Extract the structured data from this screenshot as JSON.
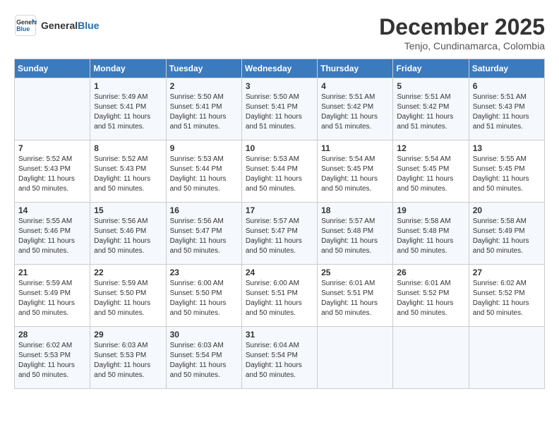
{
  "header": {
    "logo_line1": "General",
    "logo_line2": "Blue",
    "month": "December 2025",
    "location": "Tenjo, Cundinamarca, Colombia"
  },
  "days_of_week": [
    "Sunday",
    "Monday",
    "Tuesday",
    "Wednesday",
    "Thursday",
    "Friday",
    "Saturday"
  ],
  "weeks": [
    [
      {
        "day": "",
        "info": ""
      },
      {
        "day": "1",
        "info": "Sunrise: 5:49 AM\nSunset: 5:41 PM\nDaylight: 11 hours\nand 51 minutes."
      },
      {
        "day": "2",
        "info": "Sunrise: 5:50 AM\nSunset: 5:41 PM\nDaylight: 11 hours\nand 51 minutes."
      },
      {
        "day": "3",
        "info": "Sunrise: 5:50 AM\nSunset: 5:41 PM\nDaylight: 11 hours\nand 51 minutes."
      },
      {
        "day": "4",
        "info": "Sunrise: 5:51 AM\nSunset: 5:42 PM\nDaylight: 11 hours\nand 51 minutes."
      },
      {
        "day": "5",
        "info": "Sunrise: 5:51 AM\nSunset: 5:42 PM\nDaylight: 11 hours\nand 51 minutes."
      },
      {
        "day": "6",
        "info": "Sunrise: 5:51 AM\nSunset: 5:43 PM\nDaylight: 11 hours\nand 51 minutes."
      }
    ],
    [
      {
        "day": "7",
        "info": "Sunrise: 5:52 AM\nSunset: 5:43 PM\nDaylight: 11 hours\nand 50 minutes."
      },
      {
        "day": "8",
        "info": "Sunrise: 5:52 AM\nSunset: 5:43 PM\nDaylight: 11 hours\nand 50 minutes."
      },
      {
        "day": "9",
        "info": "Sunrise: 5:53 AM\nSunset: 5:44 PM\nDaylight: 11 hours\nand 50 minutes."
      },
      {
        "day": "10",
        "info": "Sunrise: 5:53 AM\nSunset: 5:44 PM\nDaylight: 11 hours\nand 50 minutes."
      },
      {
        "day": "11",
        "info": "Sunrise: 5:54 AM\nSunset: 5:45 PM\nDaylight: 11 hours\nand 50 minutes."
      },
      {
        "day": "12",
        "info": "Sunrise: 5:54 AM\nSunset: 5:45 PM\nDaylight: 11 hours\nand 50 minutes."
      },
      {
        "day": "13",
        "info": "Sunrise: 5:55 AM\nSunset: 5:45 PM\nDaylight: 11 hours\nand 50 minutes."
      }
    ],
    [
      {
        "day": "14",
        "info": "Sunrise: 5:55 AM\nSunset: 5:46 PM\nDaylight: 11 hours\nand 50 minutes."
      },
      {
        "day": "15",
        "info": "Sunrise: 5:56 AM\nSunset: 5:46 PM\nDaylight: 11 hours\nand 50 minutes."
      },
      {
        "day": "16",
        "info": "Sunrise: 5:56 AM\nSunset: 5:47 PM\nDaylight: 11 hours\nand 50 minutes."
      },
      {
        "day": "17",
        "info": "Sunrise: 5:57 AM\nSunset: 5:47 PM\nDaylight: 11 hours\nand 50 minutes."
      },
      {
        "day": "18",
        "info": "Sunrise: 5:57 AM\nSunset: 5:48 PM\nDaylight: 11 hours\nand 50 minutes."
      },
      {
        "day": "19",
        "info": "Sunrise: 5:58 AM\nSunset: 5:48 PM\nDaylight: 11 hours\nand 50 minutes."
      },
      {
        "day": "20",
        "info": "Sunrise: 5:58 AM\nSunset: 5:49 PM\nDaylight: 11 hours\nand 50 minutes."
      }
    ],
    [
      {
        "day": "21",
        "info": "Sunrise: 5:59 AM\nSunset: 5:49 PM\nDaylight: 11 hours\nand 50 minutes."
      },
      {
        "day": "22",
        "info": "Sunrise: 5:59 AM\nSunset: 5:50 PM\nDaylight: 11 hours\nand 50 minutes."
      },
      {
        "day": "23",
        "info": "Sunrise: 6:00 AM\nSunset: 5:50 PM\nDaylight: 11 hours\nand 50 minutes."
      },
      {
        "day": "24",
        "info": "Sunrise: 6:00 AM\nSunset: 5:51 PM\nDaylight: 11 hours\nand 50 minutes."
      },
      {
        "day": "25",
        "info": "Sunrise: 6:01 AM\nSunset: 5:51 PM\nDaylight: 11 hours\nand 50 minutes."
      },
      {
        "day": "26",
        "info": "Sunrise: 6:01 AM\nSunset: 5:52 PM\nDaylight: 11 hours\nand 50 minutes."
      },
      {
        "day": "27",
        "info": "Sunrise: 6:02 AM\nSunset: 5:52 PM\nDaylight: 11 hours\nand 50 minutes."
      }
    ],
    [
      {
        "day": "28",
        "info": "Sunrise: 6:02 AM\nSunset: 5:53 PM\nDaylight: 11 hours\nand 50 minutes."
      },
      {
        "day": "29",
        "info": "Sunrise: 6:03 AM\nSunset: 5:53 PM\nDaylight: 11 hours\nand 50 minutes."
      },
      {
        "day": "30",
        "info": "Sunrise: 6:03 AM\nSunset: 5:54 PM\nDaylight: 11 hours\nand 50 minutes."
      },
      {
        "day": "31",
        "info": "Sunrise: 6:04 AM\nSunset: 5:54 PM\nDaylight: 11 hours\nand 50 minutes."
      },
      {
        "day": "",
        "info": ""
      },
      {
        "day": "",
        "info": ""
      },
      {
        "day": "",
        "info": ""
      }
    ]
  ]
}
